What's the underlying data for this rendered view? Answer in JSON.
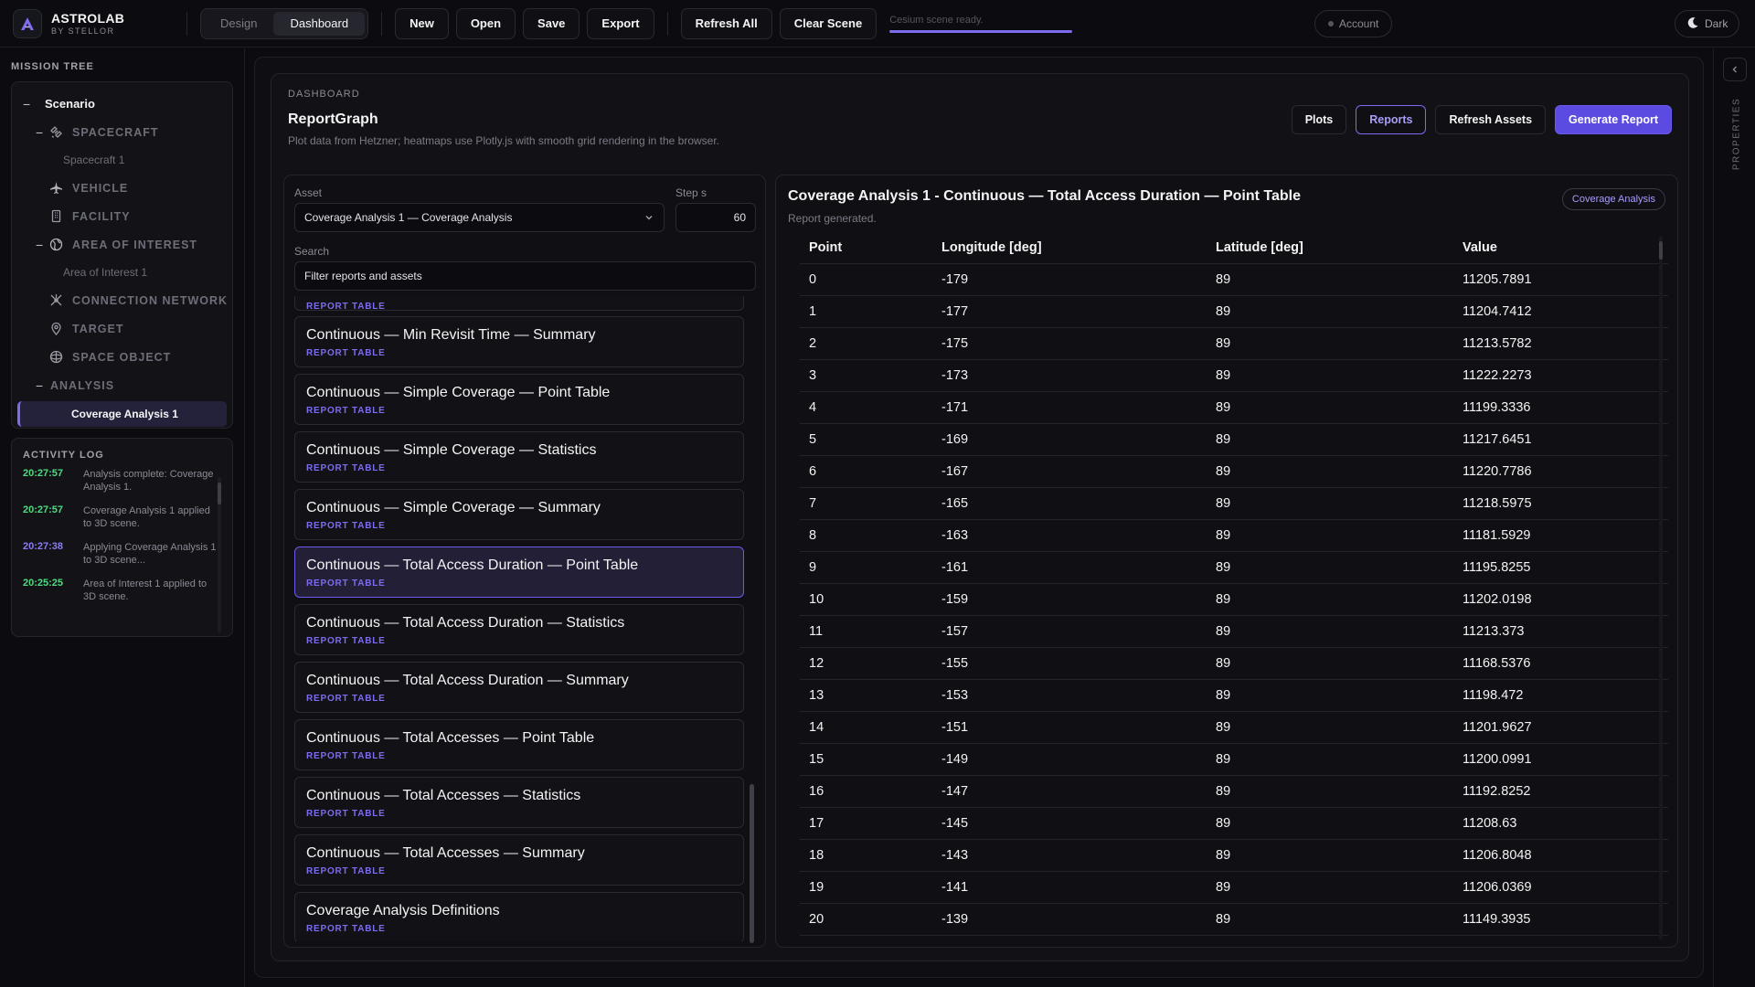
{
  "app": {
    "name": "ASTROLAB",
    "byline": "BY STELLOR"
  },
  "mode_tabs": [
    {
      "label": "Design",
      "active": false
    },
    {
      "label": "Dashboard",
      "active": true
    }
  ],
  "toolbar": {
    "new": "New",
    "open": "Open",
    "save": "Save",
    "export": "Export",
    "refresh_all": "Refresh All",
    "clear_scene": "Clear Scene"
  },
  "status": {
    "text": "Cesium scene ready.",
    "progress": 1.0
  },
  "account": "Account",
  "theme": "Dark",
  "mission_tree": {
    "title": "MISSION TREE",
    "root": "Scenario",
    "items": [
      {
        "label": "SPACECRAFT",
        "children": [
          "Spacecraft 1"
        ]
      },
      {
        "label": "VEHICLE"
      },
      {
        "label": "FACILITY"
      },
      {
        "label": "AREA OF INTEREST",
        "children": [
          "Area of Interest 1"
        ]
      },
      {
        "label": "CONNECTION NETWORK"
      },
      {
        "label": "TARGET"
      },
      {
        "label": "SPACE OBJECT"
      },
      {
        "label": "ANALYSIS",
        "children": [
          "Coverage Analysis 1"
        ]
      }
    ]
  },
  "activity_log": {
    "title": "ACTIVITY LOG",
    "entries": [
      {
        "time": "20:27:57",
        "message": "Analysis complete: Coverage Analysis 1.",
        "color": "#4ade80"
      },
      {
        "time": "20:27:57",
        "message": "Coverage Analysis 1 applied to 3D scene.",
        "color": "#4ade80"
      },
      {
        "time": "20:27:38",
        "message": "Applying Coverage Analysis 1 to 3D scene...",
        "color": "#8b7cf6"
      },
      {
        "time": "20:25:25",
        "message": "Area of Interest 1 applied to 3D scene.",
        "color": "#4ade80"
      }
    ]
  },
  "dashboard": {
    "kicker": "DASHBOARD",
    "title": "ReportGraph",
    "subtitle": "Plot data from Hetzner; heatmaps use Plotly.js with smooth grid rendering in the browser.",
    "actions": {
      "plots": "Plots",
      "reports": "Reports",
      "refresh_assets": "Refresh Assets",
      "generate_report": "Generate Report"
    }
  },
  "asset_panel": {
    "asset_label": "Asset",
    "asset_value": "Coverage Analysis 1 — Coverage Analysis",
    "step_label": "Step s",
    "step_value": "60",
    "search_label": "Search",
    "search_value": "Filter reports and assets",
    "report_kind": "REPORT TABLE",
    "reports": [
      "Continuous — Min Revisit Time — Summary",
      "Continuous — Simple Coverage — Point Table",
      "Continuous — Simple Coverage — Statistics",
      "Continuous — Simple Coverage — Summary",
      "Continuous — Total Access Duration — Point Table",
      "Continuous — Total Access Duration — Statistics",
      "Continuous — Total Access Duration — Summary",
      "Continuous — Total Accesses — Point Table",
      "Continuous — Total Accesses — Statistics",
      "Continuous — Total Accesses — Summary",
      "Coverage Analysis Definitions"
    ],
    "selected_index": 4
  },
  "report": {
    "title": "Coverage Analysis 1 - Continuous — Total Access Duration — Point Table",
    "status": "Report generated.",
    "tag": "Coverage Analysis",
    "columns": [
      "Point",
      "Longitude [deg]",
      "Latitude [deg]",
      "Value"
    ],
    "rows": [
      [
        "0",
        "-179",
        "89",
        "11205.7891"
      ],
      [
        "1",
        "-177",
        "89",
        "11204.7412"
      ],
      [
        "2",
        "-175",
        "89",
        "11213.5782"
      ],
      [
        "3",
        "-173",
        "89",
        "11222.2273"
      ],
      [
        "4",
        "-171",
        "89",
        "11199.3336"
      ],
      [
        "5",
        "-169",
        "89",
        "11217.6451"
      ],
      [
        "6",
        "-167",
        "89",
        "11220.7786"
      ],
      [
        "7",
        "-165",
        "89",
        "11218.5975"
      ],
      [
        "8",
        "-163",
        "89",
        "11181.5929"
      ],
      [
        "9",
        "-161",
        "89",
        "11195.8255"
      ],
      [
        "10",
        "-159",
        "89",
        "11202.0198"
      ],
      [
        "11",
        "-157",
        "89",
        "11213.373"
      ],
      [
        "12",
        "-155",
        "89",
        "11168.5376"
      ],
      [
        "13",
        "-153",
        "89",
        "11198.472"
      ],
      [
        "14",
        "-151",
        "89",
        "11201.9627"
      ],
      [
        "15",
        "-149",
        "89",
        "11200.0991"
      ],
      [
        "16",
        "-147",
        "89",
        "11192.8252"
      ],
      [
        "17",
        "-145",
        "89",
        "11208.63"
      ],
      [
        "18",
        "-143",
        "89",
        "11206.8048"
      ],
      [
        "19",
        "-141",
        "89",
        "11206.0369"
      ],
      [
        "20",
        "-139",
        "89",
        "11149.3935"
      ]
    ]
  },
  "properties_label": "PROPERTIES",
  "colors": {
    "accent": "#7c6cf0",
    "primary_button": "#5b4be0",
    "success": "#4ade80"
  }
}
